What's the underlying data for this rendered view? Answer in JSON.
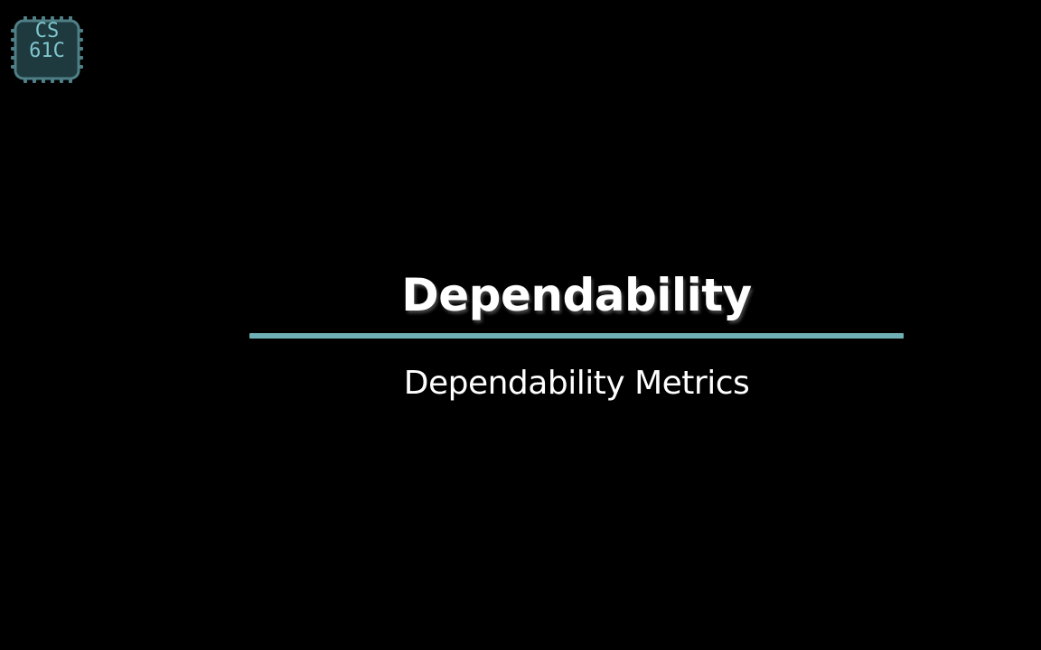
{
  "logo": {
    "line1": "CS",
    "line2": "61C",
    "icon": "cs61c-chip-logo",
    "accent_color": "#7fc6cf"
  },
  "slide": {
    "title": "Dependability",
    "subtitle": "Dependability Metrics",
    "divider_color": "#6fb0b7",
    "background_color": "#000000"
  }
}
